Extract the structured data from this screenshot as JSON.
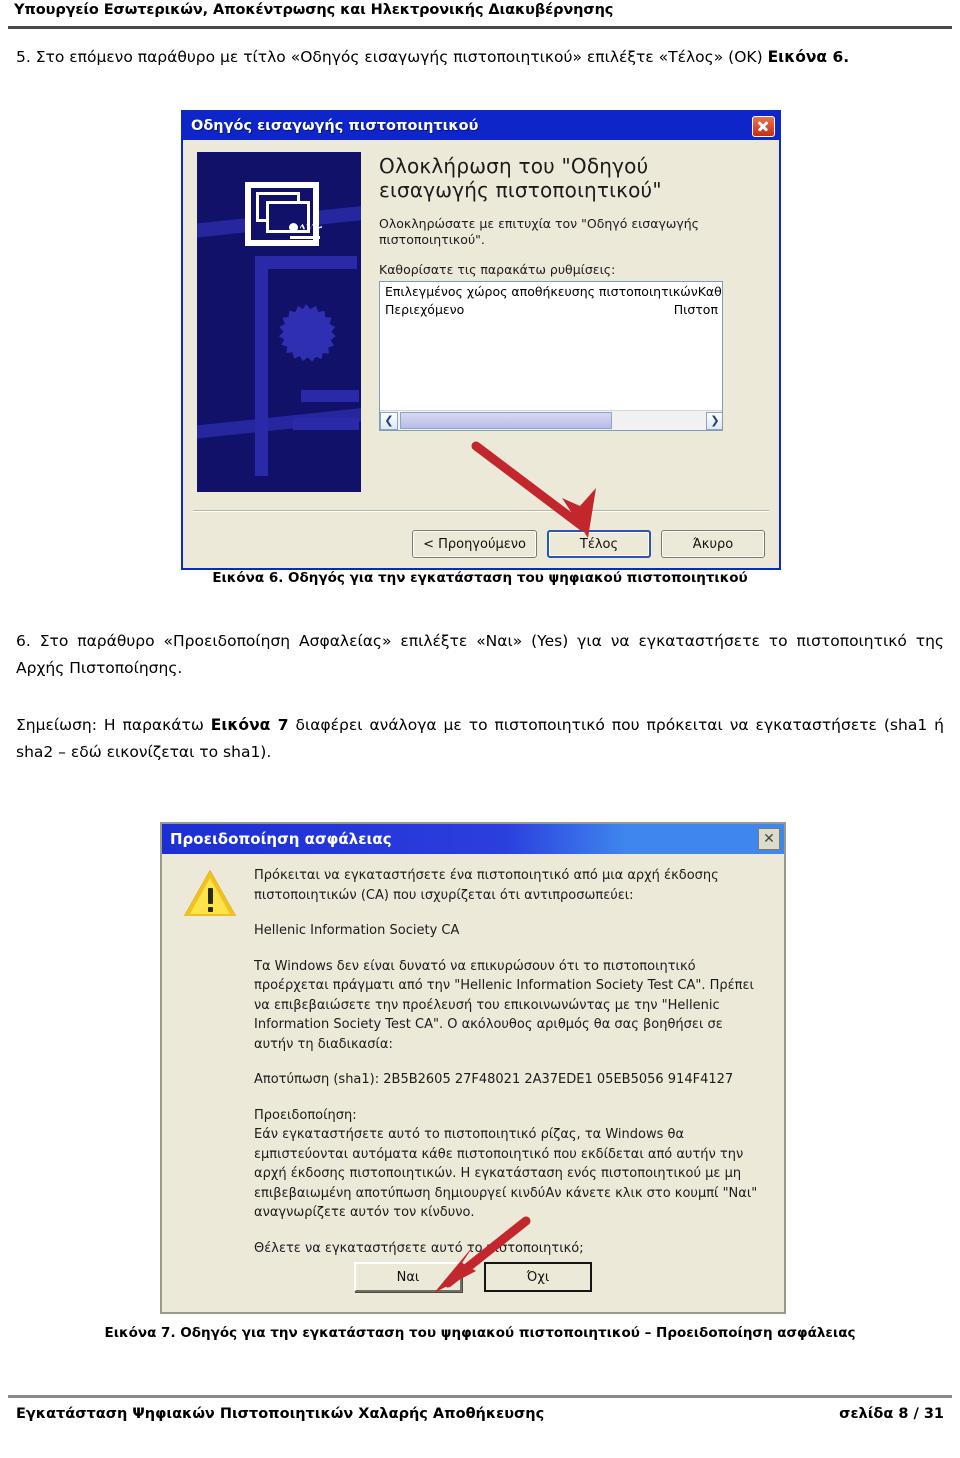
{
  "header": {
    "title": "Υπουργείο Εσωτερικών, Αποκέντρωσης και Ηλεκτρονικής Διακυβέρνησης"
  },
  "footer": {
    "left": "Εγκατάσταση Ψηφιακών Πιστοποιητικών Χαλαρής Αποθήκευσης",
    "page": "σελίδα 8 / 31"
  },
  "steps": {
    "step5": {
      "text_before": "5. Στο επόμενο παράθυρο με τίτλο «Οδηγός εισαγωγής πιστοποιητικού» επιλέξτε «Τέλος» (OK) ",
      "text_bold": "Εικόνα 6",
      "text_after": "."
    },
    "step6": {
      "text": "6. Στο παράθυρο «Προειδοποίηση Ασφαλείας» επιλέξτε «Ναι» (Yes) για να εγκαταστήσετε το πιστοποιητικό της Αρχής Πιστοποίησης."
    },
    "note": {
      "text_before": "Σημείωση: Η παρακάτω ",
      "text_bold": "Εικόνα 7",
      "text_after": " διαφέρει ανάλογα με το πιστοποιητικό που πρόκειται να εγκαταστήσετε (sha1 ή sha2 – εδώ εικονίζεται το sha1)."
    }
  },
  "captions": {
    "figure6": "Εικόνα 6. Οδηγός για την εγκατάσταση του ψηφιακού πιστοποιητικού",
    "figure7": "Εικόνα 7. Οδηγός για την εγκατάσταση του ψηφιακού πιστοποιητικού – Προειδοποίηση ασφάλειας"
  },
  "dialog_wizard": {
    "title": "Οδηγός εισαγωγής πιστοποιητικού",
    "close_label": "✕",
    "heading": "Ολοκλήρωση του \"Οδηγού εισαγωγής πιστοποιητικού\"",
    "subtext": "Ολοκληρώσατε με επιτυχία τον \"Οδηγό εισαγωγής πιστοποιητικού\".",
    "settings_label": "Καθορίσατε τις παρακάτω ρυθμίσεις:",
    "settings_rows": [
      {
        "name": "Επιλεγμένος χώρος αποθήκευσης πιστοποιητικών",
        "value": "Καθορ"
      },
      {
        "name": "Περιεχόμενο",
        "value": "Πιστοπ"
      }
    ],
    "scroll_left": "❮",
    "scroll_right": "❯",
    "buttons": {
      "back": "< Προηγούμενο",
      "finish": "Τέλος",
      "cancel": "Άκυρο"
    }
  },
  "dialog_security": {
    "title": "Προειδοποίηση ασφάλειας",
    "close_label": "✕",
    "paragraph1": "Πρόκειται να εγκαταστήσετε ένα πιστοποιητικό από μια αρχή έκδοσης πιστοποιητικών (CA) που ισχυρίζεται ότι αντιπροσωπεύει:",
    "ca_name": "Hellenic Information Society  CA",
    "paragraph2": "Τα Windows δεν είναι δυνατό να επικυρώσουν ότι το πιστοποιητικό προέρχεται πράγματι από την \"Hellenic Information Society Test CA\". Πρέπει να επιβεβαιώσετε την προέλευσή του επικοινωνώντας με την \"Hellenic Information Society Test CA\". Ο ακόλουθος αριθμός θα σας βοηθήσει σε αυτήν τη διαδικασία:",
    "thumbprint": "Αποτύπωση (sha1): 2B5B2605 27F48021 2A37EDE1 05EB5056 914F4127",
    "warning_title": "Προειδοποίηση:",
    "warning_body": "Εάν εγκαταστήσετε αυτό το πιστοποιητικό ρίζας, τα Windows θα εμπιστεύονται αυτόματα κάθε πιστοποιητικό που εκδίδεται από αυτήν την αρχή έκδοσης πιστοποιητικών. Η εγκατάσταση ενός πιστοποιητικού με μη επιβεβαιωμένη αποτύπωση δημιουργεί κινδύΑν κάνετε κλικ στο κουμπί \"Ναι\" αναγνωρίζετε αυτόν τον κίνδυνο.",
    "question": "Θέλετε να εγκαταστήσετε αυτό το πιστοποιητικό;",
    "buttons": {
      "yes": "Ναι",
      "no": "Όχι"
    }
  },
  "annotations": {
    "arrow_color": "#c1272d",
    "arrow1_target": "Τέλος",
    "arrow2_target": "Ναι"
  }
}
